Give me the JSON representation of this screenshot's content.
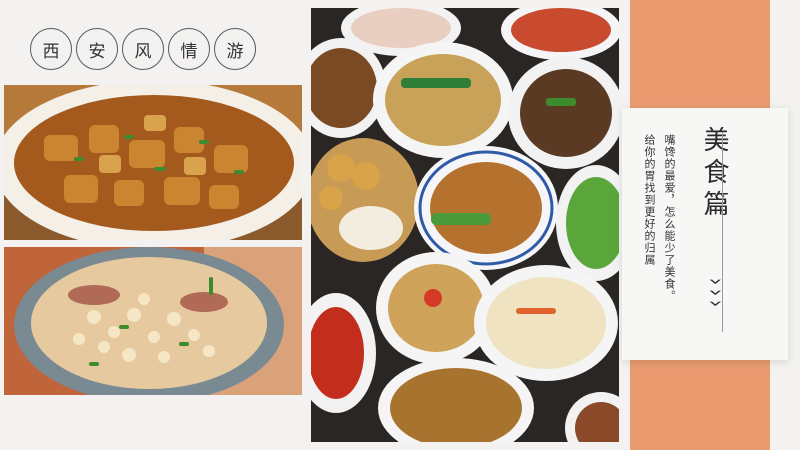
{
  "title_chars": [
    "西",
    "安",
    "风",
    "情",
    "游"
  ],
  "card": {
    "heading": "美食篇",
    "line1": "嘴馋的最爱，怎么能少了美食。",
    "line2": "给你的胃找到更好的归属"
  },
  "colors": {
    "background": "#f3f2f0",
    "accent_orange": "#e99a6f",
    "card_bg": "#f7f7f6",
    "text_dark": "#333333"
  },
  "icons": {
    "chevrons": "triple-chevron-down-icon"
  },
  "photos": [
    {
      "name": "braised-meat-dish-photo"
    },
    {
      "name": "yangrou-paomo-soup-photo"
    },
    {
      "name": "xian-food-spread-photo"
    }
  ]
}
